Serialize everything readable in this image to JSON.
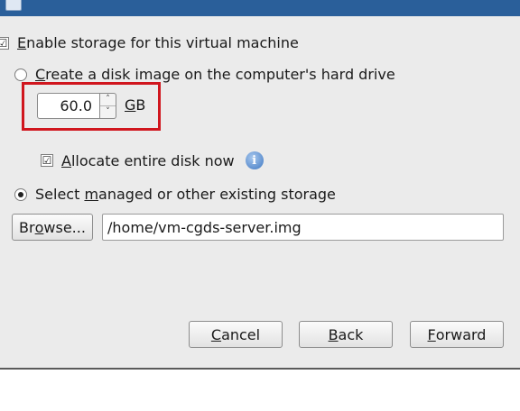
{
  "storage": {
    "enable_label_pre": "",
    "enable_label_key": "E",
    "enable_label_post": "nable storage for this virtual machine",
    "enable_checked": "☑",
    "create_label_key": "C",
    "create_label_post": "reate a disk image on the computer's hard drive",
    "disk_size_value": "60.0",
    "spin_up": "˄",
    "spin_down": "˅",
    "disk_unit_key": "G",
    "disk_unit_post": "B",
    "allocate_label_key": "A",
    "allocate_label_post": "llocate entire disk now",
    "allocate_checked": "☑",
    "info_glyph": "i",
    "select_label_pre": "Select ",
    "select_label_key": "m",
    "select_label_post": "anaged or other existing storage",
    "browse_label_pre": "Br",
    "browse_label_key": "o",
    "browse_label_post": "wse...",
    "path_value": "/home/vm-cgds-server.img"
  },
  "buttons": {
    "cancel_key": "C",
    "cancel_post": "ancel",
    "back_key": "B",
    "back_post": "ack",
    "forward_key": "F",
    "forward_post": "orward"
  },
  "selection": {
    "enable_storage": true,
    "disk_mode": "existing",
    "allocate_entire_disk": true
  },
  "colors": {
    "highlight": "#d0161e",
    "titlebar": "#2a5f9a",
    "info_icon": "#3f78c2"
  },
  "icons": [
    "checkbox-checked-icon",
    "radio-icon",
    "info-icon",
    "spin-up-icon",
    "spin-down-icon"
  ]
}
